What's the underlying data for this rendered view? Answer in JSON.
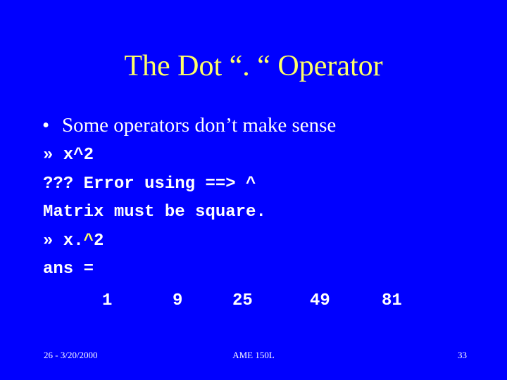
{
  "slide": {
    "title": "The Dot “. “ Operator",
    "bullet": "Some operators don’t make sense",
    "bullet_marker": "•",
    "code_lines": [
      "» x^2",
      "??? Error using ==> ^",
      "Matrix must be square.",
      "» x.",
      "ans ="
    ],
    "code_line4_hl": "^",
    "code_line4_tail": "2",
    "result_values": [
      "1",
      "9",
      "25",
      "49",
      "81"
    ],
    "accent_color": "#ffff66",
    "background_color": "#0000ff"
  },
  "footer": {
    "left": "26 - 3/20/2000",
    "center": "AME 150L",
    "page_number": "33"
  }
}
